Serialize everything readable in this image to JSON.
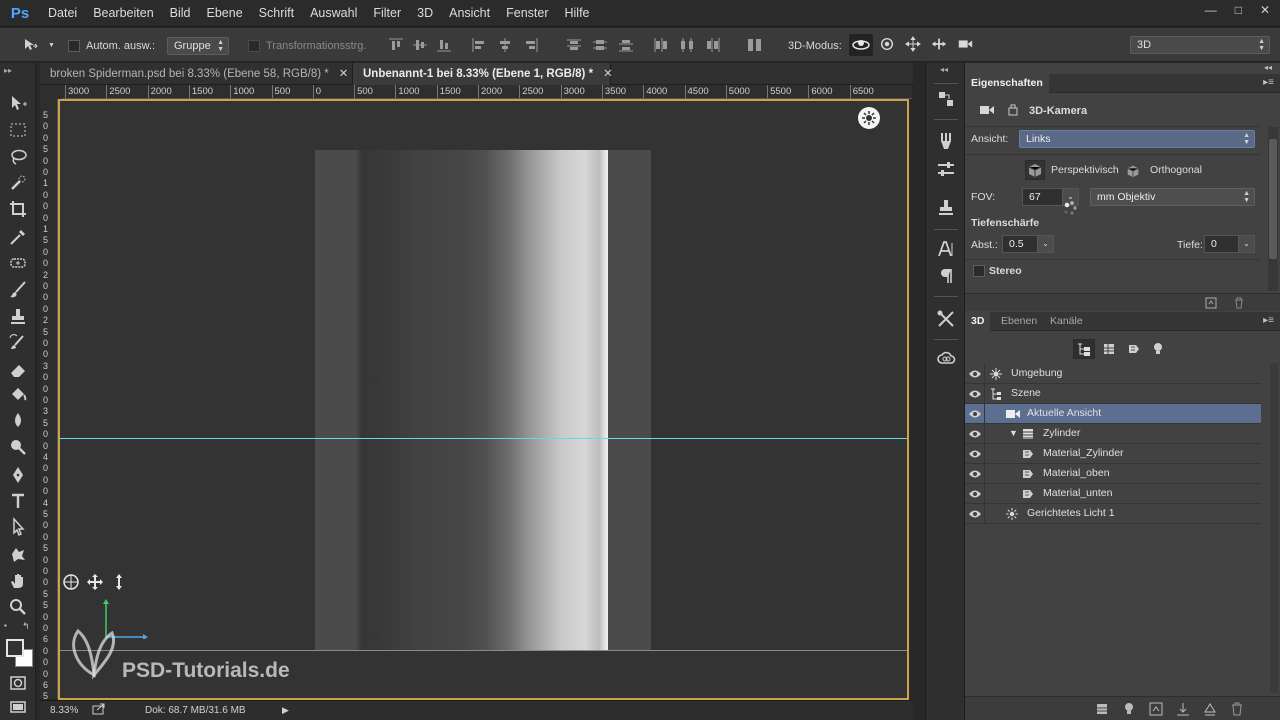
{
  "app": {
    "logo": "Ps"
  },
  "menu": [
    "Datei",
    "Bearbeiten",
    "Bild",
    "Ebene",
    "Schrift",
    "Auswahl",
    "Filter",
    "3D",
    "Ansicht",
    "Fenster",
    "Hilfe"
  ],
  "window_controls": {
    "minimize": "—",
    "maximize": "□",
    "close": "✕"
  },
  "options_bar": {
    "auto_select_label": "Autom. ausw.:",
    "auto_select_value": "Gruppe",
    "transform_label": "Transformationsstrg.",
    "mode_label": "3D-Modus:",
    "workspace_value": "3D"
  },
  "tabs": [
    {
      "label": "broken Spiderman.psd bei 8.33% (Ebene 58, RGB/8) *",
      "close": "✕"
    },
    {
      "label": "Unbenannt-1 bei 8.33% (Ebene 1, RGB/8) *",
      "close": "✕"
    }
  ],
  "ruler_top": [
    "3000",
    "2500",
    "2000",
    "1500",
    "1000",
    "500",
    "0",
    "500",
    "1000",
    "1500",
    "2000",
    "2500",
    "3000",
    "3500",
    "4000",
    "4500",
    "5000",
    "5500",
    "6000",
    "6500"
  ],
  "ruler_left": [
    "5",
    "0",
    "0",
    "5",
    "0",
    "0",
    "1",
    "0",
    "0",
    "0",
    "1",
    "5",
    "0",
    "0",
    "2",
    "0",
    "0",
    "0",
    "2",
    "5",
    "0",
    "0",
    "3",
    "0",
    "0",
    "0",
    "3",
    "5",
    "0",
    "0",
    "4",
    "0",
    "0",
    "0",
    "4",
    "5",
    "0",
    "0",
    "5",
    "0",
    "0",
    "0",
    "5",
    "5",
    "0",
    "0",
    "6",
    "0",
    "0",
    "0",
    "6",
    "5"
  ],
  "status": {
    "zoom": "8.33%",
    "doc": "Dok: 68.7 MB/31.6 MB"
  },
  "watermark": {
    "text": "PSD-Tutorials.de"
  },
  "properties": {
    "tab": "Eigenschaften",
    "title": "3D-Kamera",
    "view_label": "Ansicht:",
    "view_value": "Links",
    "perspective_label": "Perspektivisch",
    "orthogonal_label": "Orthogonal",
    "fov_label": "FOV:",
    "fov_value": "67",
    "fov_unit": "mm Objektiv",
    "dof_heading": "Tiefenschärfe",
    "distance_label": "Abst.:",
    "distance_value": "0.5",
    "depth_label": "Tiefe:",
    "depth_value": "0",
    "stereo_label": "Stereo"
  },
  "layers_panel": {
    "tabs": [
      "3D",
      "Ebenen",
      "Kanäle"
    ],
    "items": [
      {
        "name": "Umgebung",
        "icon": "environment-icon",
        "indent": 0,
        "selected": false
      },
      {
        "name": "Szene",
        "icon": "scene-icon",
        "indent": 0,
        "selected": false
      },
      {
        "name": "Aktuelle Ansicht",
        "icon": "camera-icon",
        "indent": 1,
        "selected": true
      },
      {
        "name": "Zylinder",
        "icon": "mesh-icon",
        "indent": 1,
        "selected": false
      },
      {
        "name": "Material_Zylinder",
        "icon": "material-icon",
        "indent": 2,
        "selected": false
      },
      {
        "name": "Material_oben",
        "icon": "material-icon",
        "indent": 2,
        "selected": false
      },
      {
        "name": "Material_unten",
        "icon": "material-icon",
        "indent": 2,
        "selected": false
      },
      {
        "name": "Gerichtetes Licht 1",
        "icon": "light-icon",
        "indent": 1,
        "selected": false
      }
    ]
  },
  "colors": {
    "accent": "#5c6f91",
    "canvas_border": "#c9a44a",
    "guide": "#5fe0e0",
    "logo": "#4fa8ff"
  }
}
